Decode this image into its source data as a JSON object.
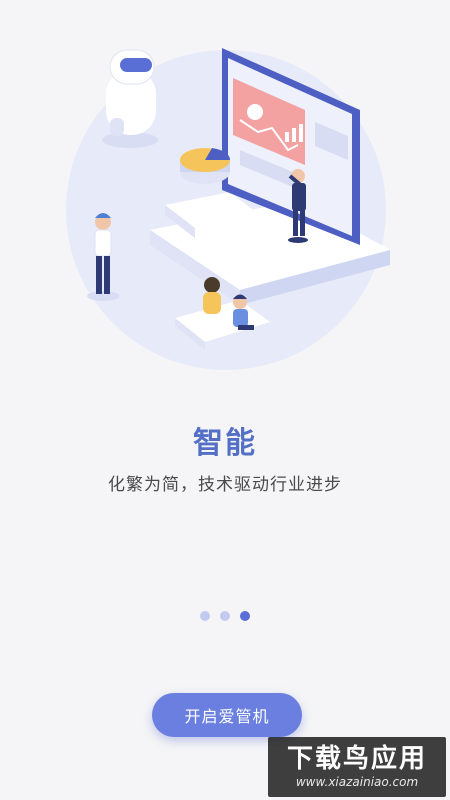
{
  "onboarding": {
    "title": "智能",
    "subtitle": "化繁为简，技术驱动行业进步",
    "button_label": "开启爱管机",
    "page_count": 3,
    "active_page": 3
  },
  "watermark": {
    "name": "下载鸟应用",
    "url": "www.xiazainiao.com"
  },
  "colors": {
    "accent": "#5470c6",
    "button": "#6a7fe0",
    "dot_inactive": "#c3caf0",
    "dot_active": "#5a6fd6",
    "background": "#f5f5f7"
  },
  "icons": [
    "robot-figure",
    "monitor-chart",
    "pie-chart-icon",
    "person-figure"
  ]
}
